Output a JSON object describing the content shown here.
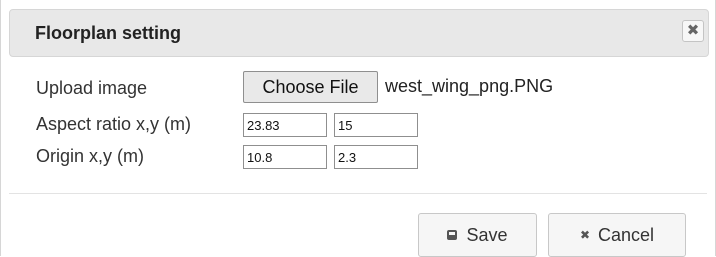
{
  "dialog": {
    "title": "Floorplan setting",
    "close_icon": "close-icon",
    "close_glyph": "✖"
  },
  "form": {
    "upload_label": "Upload image",
    "choose_file_label": "Choose File",
    "file_name": "west_wing_png.PNG",
    "aspect_label": "Aspect ratio x,y (m)",
    "aspect_x": "23.83",
    "aspect_y": "15",
    "origin_label": "Origin x,y (m)",
    "origin_x": "10.8",
    "origin_y": "2.3"
  },
  "footer": {
    "save_label": "Save",
    "save_icon": "save-icon",
    "cancel_label": "Cancel",
    "cancel_icon": "cancel-icon",
    "cancel_glyph": "✖"
  }
}
